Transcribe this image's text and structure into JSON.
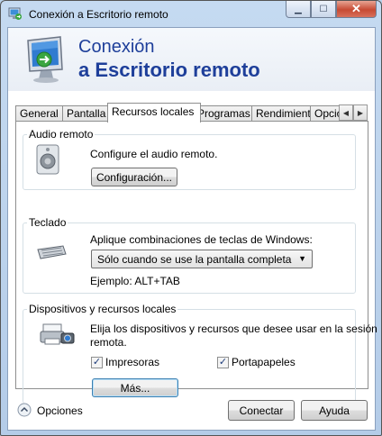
{
  "window": {
    "title": "Conexión a Escritorio remoto"
  },
  "banner": {
    "line1": "Conexión",
    "line2": "a Escritorio remoto"
  },
  "tabs": [
    {
      "label": "General"
    },
    {
      "label": "Pantalla"
    },
    {
      "label": "Recursos locales"
    },
    {
      "label": "Programas"
    },
    {
      "label": "Rendimiento"
    },
    {
      "label": "Opcio"
    }
  ],
  "audio": {
    "group_label": "Audio remoto",
    "description": "Configure el audio remoto.",
    "button_label": "Configuración..."
  },
  "keyboard": {
    "group_label": "Teclado",
    "description": "Aplique combinaciones de teclas de Windows:",
    "selected_option": "Sólo cuando se use la pantalla completa",
    "example": "Ejemplo: ALT+TAB"
  },
  "devices": {
    "group_label": "Dispositivos y recursos locales",
    "description_line1": "Elija los dispositivos y recursos que desee usar en la sesión",
    "description_line2": "remota.",
    "printers_label": "Impresoras",
    "printers_checked": true,
    "clipboard_label": "Portapapeles",
    "clipboard_checked": true,
    "more_button": "Más..."
  },
  "footer": {
    "options_label": "Opciones",
    "connect_button": "Conectar",
    "help_button": "Ayuda"
  }
}
